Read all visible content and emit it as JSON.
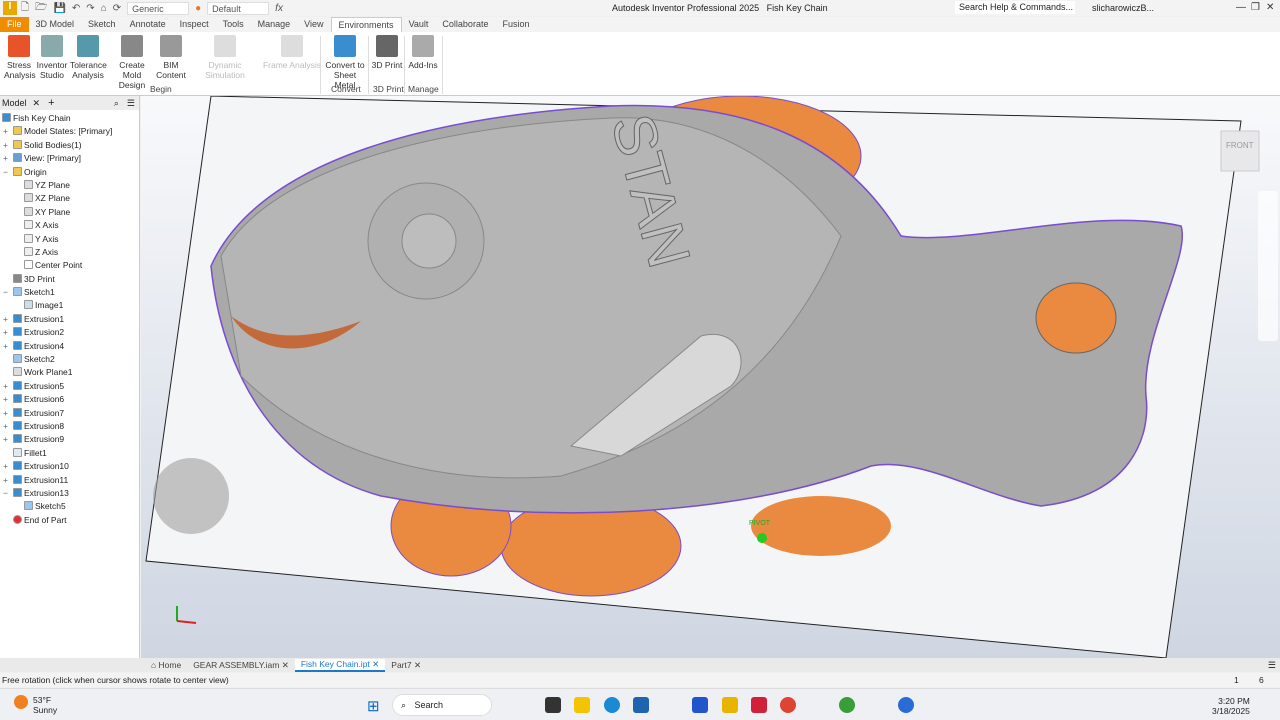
{
  "app": {
    "title": "Autodesk Inventor Professional 2025",
    "document": "Fish Key Chain",
    "logo": "I",
    "search_placeholder": "Search Help & Commands...",
    "user": "slicharowiczB...",
    "material": "Generic",
    "appearance": "Default"
  },
  "tabs": [
    "File",
    "3D Model",
    "Sketch",
    "Annotate",
    "Inspect",
    "Tools",
    "Manage",
    "View",
    "Environments",
    "Vault",
    "Collaborate",
    "Fusion"
  ],
  "ribbon": {
    "buttons": [
      {
        "l1": "Stress",
        "l2": "Analysis",
        "color": "#e8542a"
      },
      {
        "l1": "Inventor",
        "l2": "Studio",
        "color": "#8aa"
      },
      {
        "l1": "Tolerance",
        "l2": "Analysis",
        "color": "#59a"
      },
      {
        "l1": "Create",
        "l2": "Mold Design",
        "color": "#888"
      },
      {
        "l1": "BIM",
        "l2": "Content",
        "color": "#999"
      },
      {
        "l1": "Dynamic Simulation",
        "l2": "",
        "color": "#ddd"
      },
      {
        "l1": "Frame Analysis",
        "l2": "",
        "color": "#ddd"
      },
      {
        "l1": "Convert to",
        "l2": "Sheet Metal",
        "color": "#3a8ed0"
      },
      {
        "l1": "3D Print",
        "l2": "",
        "color": "#666"
      },
      {
        "l1": "Add-Ins",
        "l2": "",
        "color": "#aaa"
      }
    ],
    "groups": [
      "Begin",
      "Convert",
      "3D Print",
      "Manage"
    ]
  },
  "browser": {
    "tab": "Model",
    "items": [
      {
        "label": "Fish Key Chain",
        "lvl": 0,
        "pm": "",
        "icon": "part-icon"
      },
      {
        "label": "Model States: [Primary]",
        "lvl": 1,
        "pm": "+",
        "icon": "folder-icon"
      },
      {
        "label": "Solid Bodies(1)",
        "lvl": 1,
        "pm": "+",
        "icon": "folder-icon"
      },
      {
        "label": "View: [Primary]",
        "lvl": 1,
        "pm": "+",
        "icon": "view-icon"
      },
      {
        "label": "Origin",
        "lvl": 1,
        "pm": "−",
        "icon": "folder-icon"
      },
      {
        "label": "YZ Plane",
        "lvl": 2,
        "pm": "",
        "icon": "plane-icon"
      },
      {
        "label": "XZ Plane",
        "lvl": 2,
        "pm": "",
        "icon": "plane-icon"
      },
      {
        "label": "XY Plane",
        "lvl": 2,
        "pm": "",
        "icon": "plane-icon"
      },
      {
        "label": "X Axis",
        "lvl": 2,
        "pm": "",
        "icon": "axis-icon"
      },
      {
        "label": "Y Axis",
        "lvl": 2,
        "pm": "",
        "icon": "axis-icon"
      },
      {
        "label": "Z Axis",
        "lvl": 2,
        "pm": "",
        "icon": "axis-icon"
      },
      {
        "label": "Center Point",
        "lvl": 2,
        "pm": "",
        "icon": "point-icon"
      },
      {
        "label": "3D Print",
        "lvl": 1,
        "pm": "",
        "icon": "print-icon"
      },
      {
        "label": "Sketch1",
        "lvl": 1,
        "pm": "−",
        "icon": "sketch-icon"
      },
      {
        "label": "Image1",
        "lvl": 2,
        "pm": "",
        "icon": "image-icon"
      },
      {
        "label": "Extrusion1",
        "lvl": 1,
        "pm": "+",
        "icon": "extrusion-icon"
      },
      {
        "label": "Extrusion2",
        "lvl": 1,
        "pm": "+",
        "icon": "extrusion-icon"
      },
      {
        "label": "Extrusion4",
        "lvl": 1,
        "pm": "+",
        "icon": "extrusion-icon"
      },
      {
        "label": "Sketch2",
        "lvl": 1,
        "pm": "",
        "icon": "sketch-icon"
      },
      {
        "label": "Work Plane1",
        "lvl": 1,
        "pm": "",
        "icon": "plane-icon"
      },
      {
        "label": "Extrusion5",
        "lvl": 1,
        "pm": "+",
        "icon": "extrusion-icon"
      },
      {
        "label": "Extrusion6",
        "lvl": 1,
        "pm": "+",
        "icon": "extrusion-icon"
      },
      {
        "label": "Extrusion7",
        "lvl": 1,
        "pm": "+",
        "icon": "extrusion-icon"
      },
      {
        "label": "Extrusion8",
        "lvl": 1,
        "pm": "+",
        "icon": "extrusion-icon"
      },
      {
        "label": "Extrusion9",
        "lvl": 1,
        "pm": "+",
        "icon": "extrusion-icon"
      },
      {
        "label": "Fillet1",
        "lvl": 1,
        "pm": "",
        "icon": "fillet-icon"
      },
      {
        "label": "Extrusion10",
        "lvl": 1,
        "pm": "+",
        "icon": "extrusion-icon"
      },
      {
        "label": "Extrusion11",
        "lvl": 1,
        "pm": "+",
        "icon": "extrusion-icon"
      },
      {
        "label": "Extrusion13",
        "lvl": 1,
        "pm": "−",
        "icon": "extrusion-icon"
      },
      {
        "label": "Sketch5",
        "lvl": 2,
        "pm": "",
        "icon": "sketch-icon"
      },
      {
        "label": "End of Part",
        "lvl": 1,
        "pm": "",
        "icon": "end-of-part-icon"
      }
    ]
  },
  "viewport": {
    "emboss_text": "STAN",
    "pivot_label": "PIVOT",
    "viewcube_label": "FRONT"
  },
  "doc_tabs": [
    "Home",
    "GEAR ASSEMBLY.iam",
    "Fish Key Chain.ipt",
    "Part7"
  ],
  "status": {
    "text": "Free rotation (click when cursor shows rotate to center view)",
    "n1": "1",
    "n2": "6"
  },
  "taskbar": {
    "temp": "53°F",
    "weather": "Sunny",
    "search": "Search",
    "time": "3:20 PM",
    "date": "3/18/2025"
  }
}
